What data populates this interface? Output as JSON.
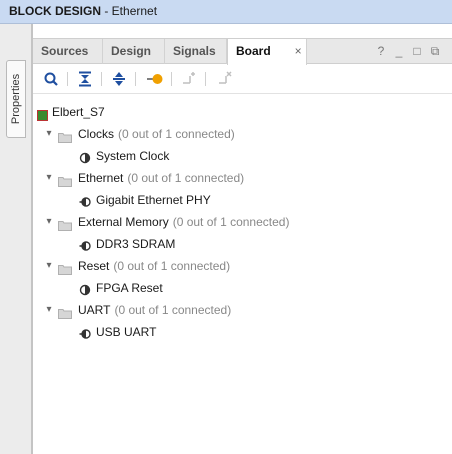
{
  "window": {
    "title_bold": "BLOCK DESIGN",
    "title_rest": " - Ethernet"
  },
  "side_tab": {
    "label": "Properties"
  },
  "tabs": [
    {
      "label": "Sources"
    },
    {
      "label": "Design"
    },
    {
      "label": "Signals"
    },
    {
      "label": "Board",
      "active": true
    }
  ],
  "tab_close": "×",
  "window_controls": {
    "help": "?",
    "minimize": "_",
    "maximize": "□",
    "float": "⧉"
  },
  "toolbar": {
    "icons": [
      "search-icon",
      "collapse-all-icon",
      "expand-all-icon",
      "auto-connect-icon",
      "connect-icon",
      "disconnect-icon"
    ]
  },
  "tree": {
    "root": "Elbert_S7",
    "groups": [
      {
        "name": "Clocks",
        "status": "(0 out of 1 connected)",
        "child": "System Clock"
      },
      {
        "name": "Ethernet",
        "status": "(0 out of 1 connected)",
        "child": "Gigabit Ethernet PHY"
      },
      {
        "name": "External Memory",
        "status": "(0 out of 1 connected)",
        "child": "DDR3 SDRAM"
      },
      {
        "name": "Reset",
        "status": "(0 out of 1 connected)",
        "child": "FPGA Reset"
      },
      {
        "name": "UART",
        "status": "(0 out of 1 connected)",
        "child": "USB UART"
      }
    ]
  },
  "colors": {
    "titlebar": "#c9daf2",
    "root_chip": "#3a8a2e",
    "accent_orange": "#f0a000",
    "toolbar_blue": "#1f4fa0"
  }
}
